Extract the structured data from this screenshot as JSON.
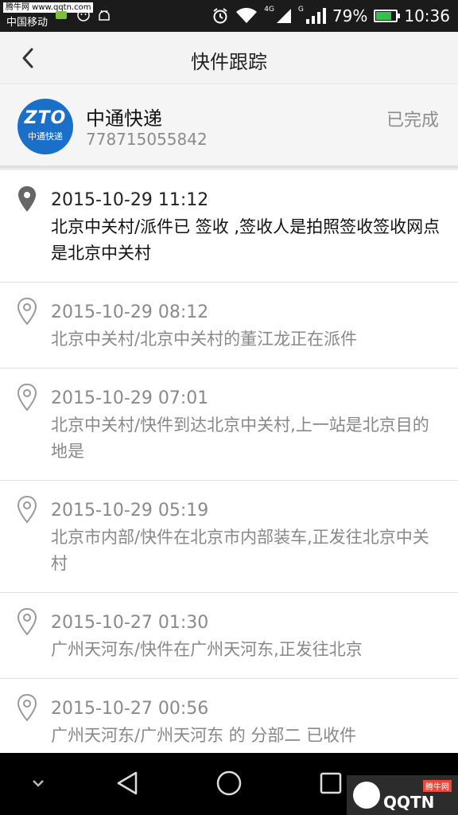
{
  "status_bar": {
    "watermark": "腾牛网 www.qqtn.com",
    "carrier": "中国移动",
    "network_label_1": "4G",
    "network_label_2": "G",
    "battery": "79%",
    "battery_level": 0.79,
    "time": "10:36"
  },
  "header": {
    "title": "快件跟踪",
    "back_icon": "chevron-left-icon"
  },
  "courier": {
    "logo_letters": "ZTO",
    "logo_subtitle": "中通快递",
    "name": "中通快递",
    "tracking_number": "778715055842",
    "status": "已完成"
  },
  "timeline": [
    {
      "time": "2015-10-29 11:12",
      "desc": "北京中关村/派件已 签收 ,签收人是拍照签收签收网点是北京中关村",
      "current": true
    },
    {
      "time": "2015-10-29 08:12",
      "desc": "北京中关村/北京中关村的董江龙正在派件",
      "current": false
    },
    {
      "time": "2015-10-29 07:01",
      "desc": "北京中关村/快件到达北京中关村,上一站是北京目的地是",
      "current": false
    },
    {
      "time": "2015-10-29 05:19",
      "desc": "北京市内部/快件在北京市内部装车,正发往北京中关村",
      "current": false
    },
    {
      "time": "2015-10-27 01:30",
      "desc": "广州天河东/快件在广州天河东,正发往北京",
      "current": false
    },
    {
      "time": "2015-10-27 00:56",
      "desc": "广州天河东/广州天河东 的 分部二 已收件",
      "current": false
    }
  ],
  "nav": {
    "watermark_text": "QQTN",
    "watermark_small": "腾牛网"
  },
  "colors": {
    "logo_blue": "#1a6fc9",
    "battery_green": "#35c24a",
    "status_bar": "#1b1b1b"
  }
}
